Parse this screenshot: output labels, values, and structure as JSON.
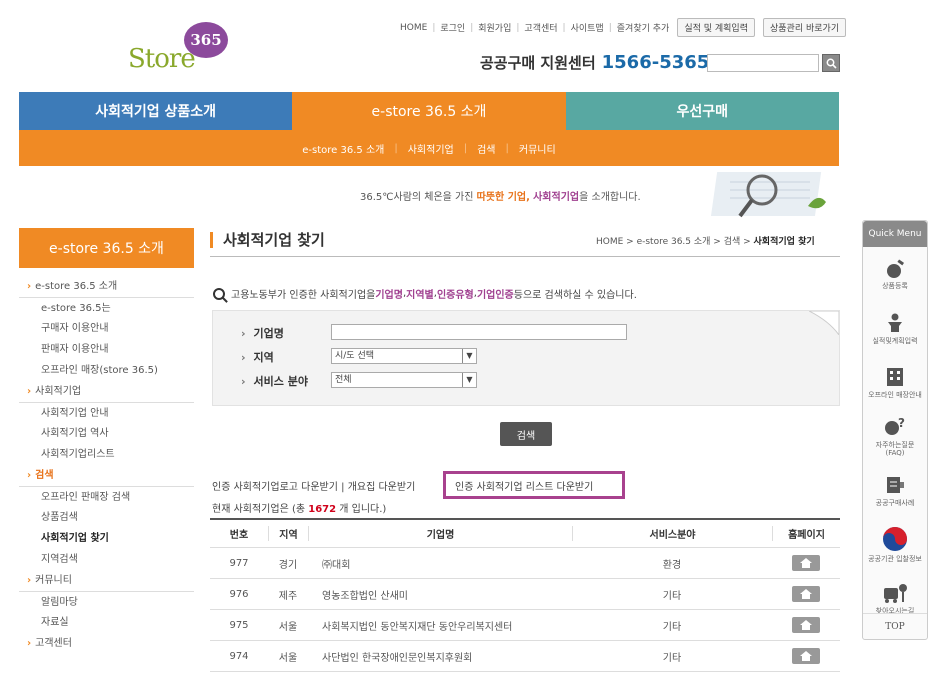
{
  "logo": {
    "text": "Store",
    "badge": "365"
  },
  "top_nav": {
    "links": [
      "HOME",
      "로그인",
      "회원가입",
      "고객센터",
      "사이트맵",
      "즐겨찾기 추가"
    ],
    "buttons": [
      "실적 및 계획입력",
      "상품관리 바로가기"
    ]
  },
  "support_center": {
    "label": "공공구매 지원센터",
    "phone": "1566-5365"
  },
  "main_nav": [
    "사회적기업 상품소개",
    "e-store 36.5 소개",
    "우선구매"
  ],
  "sub_nav": [
    "e-store 36.5 소개",
    "사회적기업",
    "검색",
    "커뮤니티"
  ],
  "banner": {
    "pre": "36.5℃사람의 체온을 가진 ",
    "hl1": "따뜻한 기업,",
    "mid": " ",
    "hl2": "사회적기업",
    "post": "을 소개합니다."
  },
  "sidebar": {
    "title": "e-store 36.5 소개",
    "items": [
      {
        "label": "e-store 36.5 소개",
        "kind": "cat"
      },
      {
        "label": "e-store 36.5는",
        "kind": "sub"
      },
      {
        "label": "구매자 이용안내",
        "kind": "sub"
      },
      {
        "label": "판매자 이용안내",
        "kind": "sub"
      },
      {
        "label": "오프라인 매장(store 36.5)",
        "kind": "sub"
      },
      {
        "label": "사회적기업",
        "kind": "cat"
      },
      {
        "label": "사회적기업 안내",
        "kind": "sub"
      },
      {
        "label": "사회적기업 역사",
        "kind": "sub"
      },
      {
        "label": "사회적기업리스트",
        "kind": "sub"
      },
      {
        "label": "검색",
        "kind": "cat-active"
      },
      {
        "label": "오프라인 판매장 검색",
        "kind": "sub"
      },
      {
        "label": "상품검색",
        "kind": "sub"
      },
      {
        "label": "사회적기업 찾기",
        "kind": "sub-current"
      },
      {
        "label": "지역검색",
        "kind": "sub"
      },
      {
        "label": "커뮤니티",
        "kind": "cat"
      },
      {
        "label": "알림마당",
        "kind": "sub"
      },
      {
        "label": "자료실",
        "kind": "sub"
      },
      {
        "label": "고객센터",
        "kind": "cat"
      }
    ]
  },
  "page": {
    "title": "사회적기업 찾기",
    "breadcrumb_prefix": "HOME > e-store 36.5 소개 > 검색 > ",
    "breadcrumb_current": "사회적기업 찾기",
    "desc": {
      "p1": "고용노동부가 인증한 사회적기업을 ",
      "k1": "기업명",
      "s1": ", ",
      "k2": "지역별",
      "s2": ", ",
      "k3": "인증유형",
      "s3": ", ",
      "k4": "기업인증",
      "p2": " 등으로 검색하실 수 있습니다."
    }
  },
  "search_form": {
    "company_label": "기업명",
    "company_value": "",
    "region_label": "지역",
    "region_value": "시/도 선택",
    "service_label": "서비스 분야",
    "service_value": "전체",
    "submit": "검색"
  },
  "downloads": {
    "d1": "인증 사회적기업로고 다운받기",
    "sep": " | ",
    "d2": "개요집 다운받기",
    "d3": "인증 사회적기업 리스트 다운받기"
  },
  "count": {
    "pre": "현재 사회적기업은 (총 ",
    "n": "1672",
    "post": " 개 입니다.)"
  },
  "table": {
    "headers": [
      "번호",
      "지역",
      "기업명",
      "서비스분야",
      "홈페이지"
    ],
    "rows": [
      {
        "no": "977",
        "region": "경기",
        "name": "㈜대회",
        "field": "환경"
      },
      {
        "no": "976",
        "region": "제주",
        "name": "영농조합법인 산새미",
        "field": "기타"
      },
      {
        "no": "975",
        "region": "서울",
        "name": "사회복지법인 동안복지재단 동안우리복지센터",
        "field": "기타"
      },
      {
        "no": "974",
        "region": "서울",
        "name": "사단법인 한국장애인문인복지후원회",
        "field": "기타"
      }
    ]
  },
  "quick_menu": {
    "title": "Quick Menu",
    "items": [
      {
        "label": "상품등록",
        "icon": "product-register-icon"
      },
      {
        "label": "실적및계획입력",
        "icon": "performance-icon"
      },
      {
        "label": "오프라인 매장안내",
        "icon": "store-icon"
      },
      {
        "label": "자주하는질문 (FAQ)",
        "icon": "faq-icon"
      },
      {
        "label": "공공구매사례",
        "icon": "case-icon"
      },
      {
        "label": "공공기관 입찰정보",
        "icon": "government-icon"
      },
      {
        "label": "찾아오시는길",
        "icon": "directions-icon"
      }
    ],
    "top": "TOP"
  },
  "colors": {
    "orange": "#f08a24",
    "blue": "#3d7bb8",
    "teal": "#58a8a2",
    "purple": "#a04090",
    "highlight_box": "#a8418e"
  }
}
